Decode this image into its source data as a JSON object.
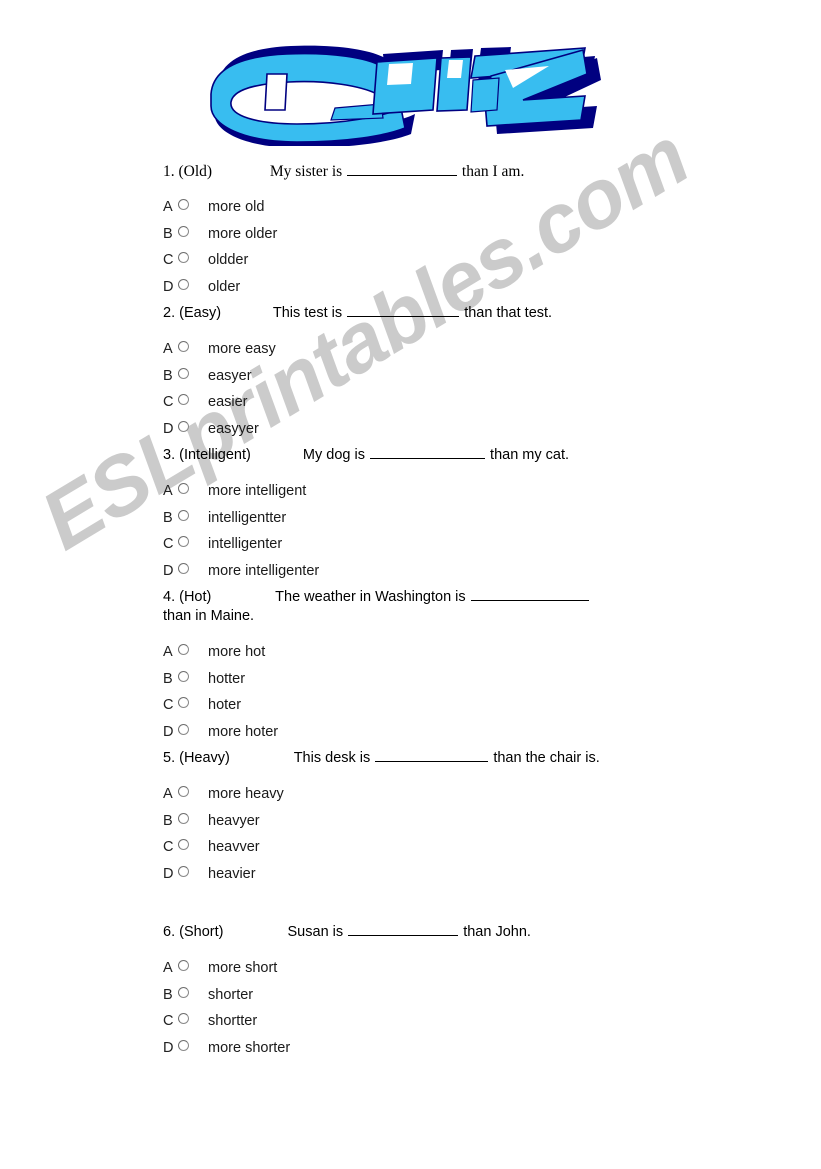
{
  "logo": {
    "text": "QUIZ",
    "fill_color": "#38BDF0",
    "shadow_color": "#000080"
  },
  "watermark": {
    "text": "ESLprintables.com",
    "color": "#CBCBCB"
  },
  "option_letters": [
    "A",
    "B",
    "C",
    "D"
  ],
  "questions": [
    {
      "number": "1.",
      "word": "(Old)",
      "sentence_before": "My sister is",
      "sentence_after": "than I am.",
      "wrapped_text": "",
      "blank_width": 110,
      "options": [
        "more old",
        "more older",
        "oldder",
        "older"
      ]
    },
    {
      "number": "2.",
      "word": "(Easy)",
      "sentence_before": "This test is",
      "sentence_after": "than that test.",
      "wrapped_text": "",
      "blank_width": 112,
      "options": [
        "more easy",
        "easyer",
        "easier",
        "easyyer"
      ]
    },
    {
      "number": "3.",
      "word": "(Intelligent)",
      "sentence_before": "My dog is",
      "sentence_after": "than my cat.",
      "wrapped_text": "",
      "blank_width": 115,
      "options": [
        "more intelligent",
        "intelligentter",
        "intelligenter",
        "more intelligenter"
      ]
    },
    {
      "number": "4.",
      "word": "(Hot)",
      "sentence_before": "The weather in Washington is",
      "sentence_after": "",
      "wrapped_text": "than in Maine.",
      "blank_width": 118,
      "options": [
        "more hot",
        "hotter",
        "hoter",
        "more hoter"
      ]
    },
    {
      "number": "5.",
      "word": "(Heavy)",
      "sentence_before": "This desk is",
      "sentence_after": "than the chair is.",
      "wrapped_text": "",
      "blank_width": 113,
      "options": [
        "more heavy",
        "heavyer",
        "heavver",
        "heavier"
      ]
    },
    {
      "number": "6.",
      "word": "(Short)",
      "sentence_before": "Susan is",
      "sentence_after": "than John.",
      "wrapped_text": "",
      "blank_width": 110,
      "options": [
        "more short",
        "shorter",
        "shortter",
        "more shorter"
      ]
    }
  ]
}
